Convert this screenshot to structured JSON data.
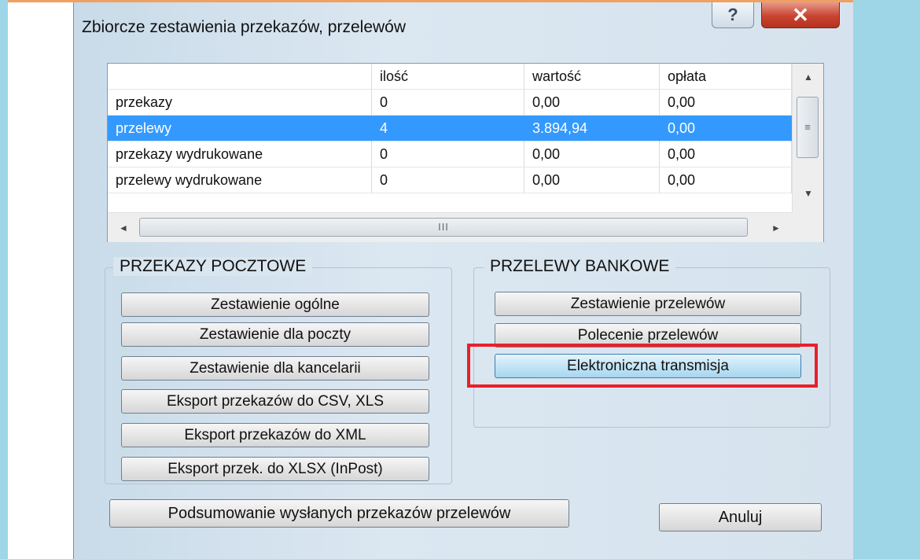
{
  "window": {
    "title": "Zbiorcze zestawienia przekazów, przelewów",
    "help_label": "?",
    "close_label": "✕"
  },
  "table": {
    "headers": [
      "",
      "ilość",
      "wartość",
      "opłata"
    ],
    "rows": [
      [
        "przekazy",
        "0",
        "0,00",
        "0,00"
      ],
      [
        "przelewy",
        "4",
        "3.894,94",
        "0,00"
      ],
      [
        "przekazy wydrukowane",
        "0",
        "0,00",
        "0,00"
      ],
      [
        "przelewy wydrukowane",
        "0",
        "0,00",
        "0,00"
      ]
    ],
    "selected_row": 1,
    "scroll_up": "▲",
    "scroll_down": "▼",
    "scroll_left": "◄",
    "scroll_right": "►",
    "vthumb_grip": "≡",
    "hthumb_grip": "III"
  },
  "przekazy_group": {
    "label": "PRZEKAZY POCZTOWE",
    "buttons": [
      "Zestawienie ogólne",
      "Zestawienie dla poczty",
      "Zestawienie dla kancelarii",
      "Eksport przekazów do CSV, XLS",
      "Eksport przekazów do XML",
      "Eksport przek. do XLSX (InPost)"
    ]
  },
  "przelewy_group": {
    "label": "PRZELEWY BANKOWE",
    "buttons": [
      "Zestawienie przelewów",
      "Polecenie przelewów",
      "Elektroniczna transmisja"
    ],
    "highlighted_button": 2
  },
  "footer": {
    "summary_button": "Podsumowanie wysłanych przekazów przelewów",
    "cancel_button": "Anuluj"
  },
  "colors": {
    "selection": "#3399ff",
    "highlight": "#e8202a",
    "background_right": "#9ed6e8"
  }
}
